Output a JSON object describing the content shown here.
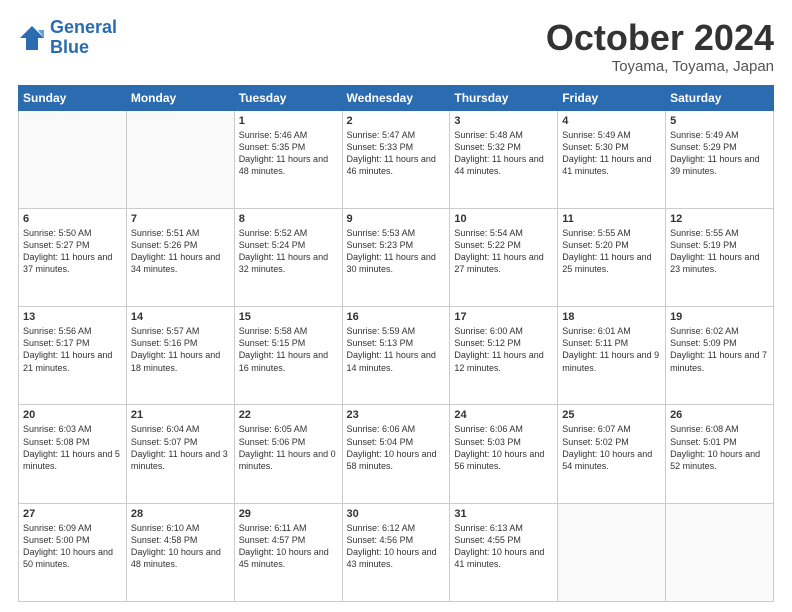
{
  "header": {
    "logo_line1": "General",
    "logo_line2": "Blue",
    "month": "October 2024",
    "location": "Toyama, Toyama, Japan"
  },
  "weekdays": [
    "Sunday",
    "Monday",
    "Tuesday",
    "Wednesday",
    "Thursday",
    "Friday",
    "Saturday"
  ],
  "weeks": [
    [
      {
        "day": "",
        "info": ""
      },
      {
        "day": "",
        "info": ""
      },
      {
        "day": "1",
        "info": "Sunrise: 5:46 AM\nSunset: 5:35 PM\nDaylight: 11 hours and 48 minutes."
      },
      {
        "day": "2",
        "info": "Sunrise: 5:47 AM\nSunset: 5:33 PM\nDaylight: 11 hours and 46 minutes."
      },
      {
        "day": "3",
        "info": "Sunrise: 5:48 AM\nSunset: 5:32 PM\nDaylight: 11 hours and 44 minutes."
      },
      {
        "day": "4",
        "info": "Sunrise: 5:49 AM\nSunset: 5:30 PM\nDaylight: 11 hours and 41 minutes."
      },
      {
        "day": "5",
        "info": "Sunrise: 5:49 AM\nSunset: 5:29 PM\nDaylight: 11 hours and 39 minutes."
      }
    ],
    [
      {
        "day": "6",
        "info": "Sunrise: 5:50 AM\nSunset: 5:27 PM\nDaylight: 11 hours and 37 minutes."
      },
      {
        "day": "7",
        "info": "Sunrise: 5:51 AM\nSunset: 5:26 PM\nDaylight: 11 hours and 34 minutes."
      },
      {
        "day": "8",
        "info": "Sunrise: 5:52 AM\nSunset: 5:24 PM\nDaylight: 11 hours and 32 minutes."
      },
      {
        "day": "9",
        "info": "Sunrise: 5:53 AM\nSunset: 5:23 PM\nDaylight: 11 hours and 30 minutes."
      },
      {
        "day": "10",
        "info": "Sunrise: 5:54 AM\nSunset: 5:22 PM\nDaylight: 11 hours and 27 minutes."
      },
      {
        "day": "11",
        "info": "Sunrise: 5:55 AM\nSunset: 5:20 PM\nDaylight: 11 hours and 25 minutes."
      },
      {
        "day": "12",
        "info": "Sunrise: 5:55 AM\nSunset: 5:19 PM\nDaylight: 11 hours and 23 minutes."
      }
    ],
    [
      {
        "day": "13",
        "info": "Sunrise: 5:56 AM\nSunset: 5:17 PM\nDaylight: 11 hours and 21 minutes."
      },
      {
        "day": "14",
        "info": "Sunrise: 5:57 AM\nSunset: 5:16 PM\nDaylight: 11 hours and 18 minutes."
      },
      {
        "day": "15",
        "info": "Sunrise: 5:58 AM\nSunset: 5:15 PM\nDaylight: 11 hours and 16 minutes."
      },
      {
        "day": "16",
        "info": "Sunrise: 5:59 AM\nSunset: 5:13 PM\nDaylight: 11 hours and 14 minutes."
      },
      {
        "day": "17",
        "info": "Sunrise: 6:00 AM\nSunset: 5:12 PM\nDaylight: 11 hours and 12 minutes."
      },
      {
        "day": "18",
        "info": "Sunrise: 6:01 AM\nSunset: 5:11 PM\nDaylight: 11 hours and 9 minutes."
      },
      {
        "day": "19",
        "info": "Sunrise: 6:02 AM\nSunset: 5:09 PM\nDaylight: 11 hours and 7 minutes."
      }
    ],
    [
      {
        "day": "20",
        "info": "Sunrise: 6:03 AM\nSunset: 5:08 PM\nDaylight: 11 hours and 5 minutes."
      },
      {
        "day": "21",
        "info": "Sunrise: 6:04 AM\nSunset: 5:07 PM\nDaylight: 11 hours and 3 minutes."
      },
      {
        "day": "22",
        "info": "Sunrise: 6:05 AM\nSunset: 5:06 PM\nDaylight: 11 hours and 0 minutes."
      },
      {
        "day": "23",
        "info": "Sunrise: 6:06 AM\nSunset: 5:04 PM\nDaylight: 10 hours and 58 minutes."
      },
      {
        "day": "24",
        "info": "Sunrise: 6:06 AM\nSunset: 5:03 PM\nDaylight: 10 hours and 56 minutes."
      },
      {
        "day": "25",
        "info": "Sunrise: 6:07 AM\nSunset: 5:02 PM\nDaylight: 10 hours and 54 minutes."
      },
      {
        "day": "26",
        "info": "Sunrise: 6:08 AM\nSunset: 5:01 PM\nDaylight: 10 hours and 52 minutes."
      }
    ],
    [
      {
        "day": "27",
        "info": "Sunrise: 6:09 AM\nSunset: 5:00 PM\nDaylight: 10 hours and 50 minutes."
      },
      {
        "day": "28",
        "info": "Sunrise: 6:10 AM\nSunset: 4:58 PM\nDaylight: 10 hours and 48 minutes."
      },
      {
        "day": "29",
        "info": "Sunrise: 6:11 AM\nSunset: 4:57 PM\nDaylight: 10 hours and 45 minutes."
      },
      {
        "day": "30",
        "info": "Sunrise: 6:12 AM\nSunset: 4:56 PM\nDaylight: 10 hours and 43 minutes."
      },
      {
        "day": "31",
        "info": "Sunrise: 6:13 AM\nSunset: 4:55 PM\nDaylight: 10 hours and 41 minutes."
      },
      {
        "day": "",
        "info": ""
      },
      {
        "day": "",
        "info": ""
      }
    ]
  ]
}
